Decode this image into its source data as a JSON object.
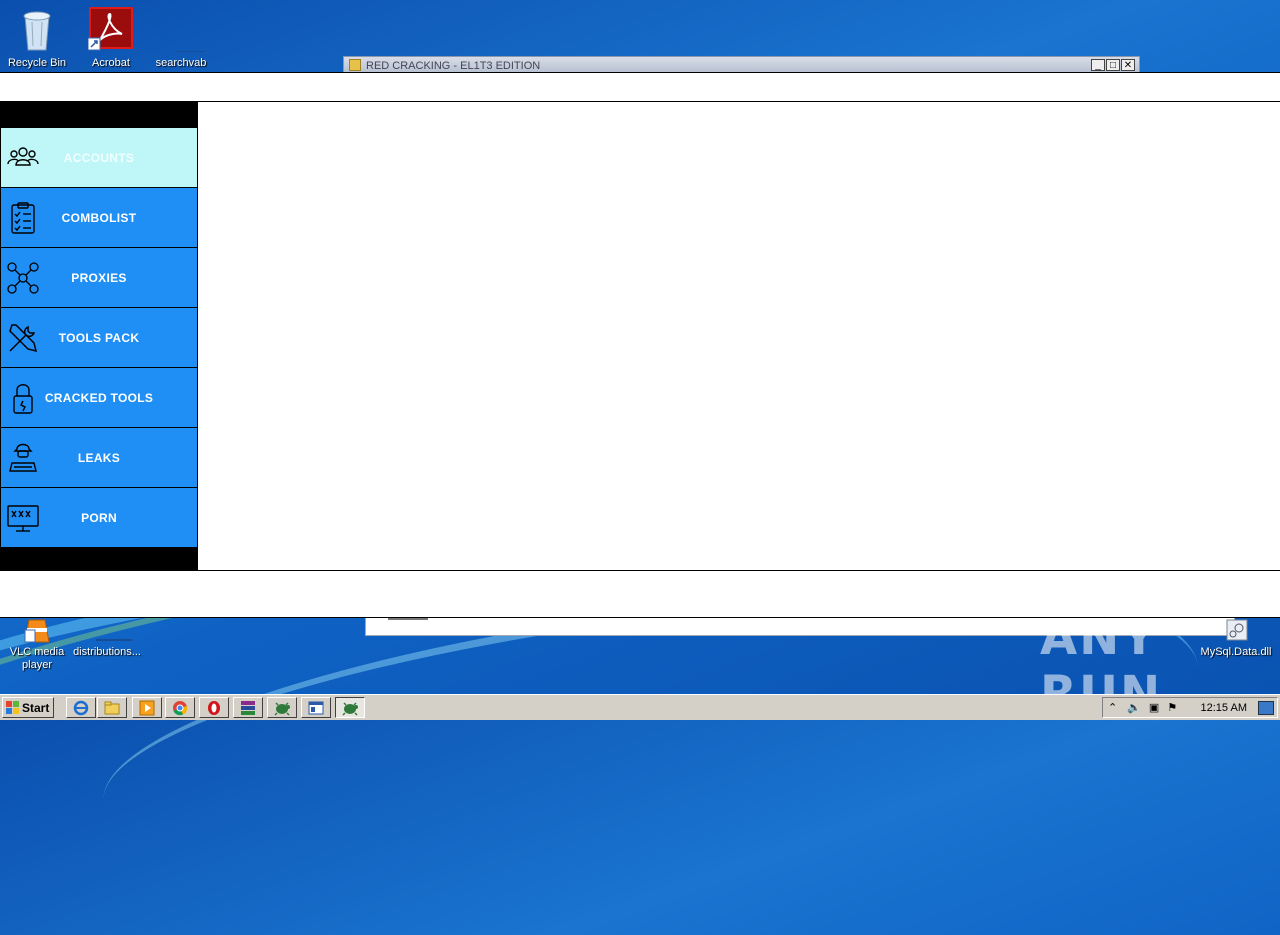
{
  "desktop": {
    "icons": [
      {
        "label": "Recycle Bin"
      },
      {
        "label": "Acrobat"
      },
      {
        "label": "searchvab"
      },
      {
        "label": "VLC media player"
      },
      {
        "label": "distributions..."
      },
      {
        "label": "MySql.Data.dll"
      }
    ],
    "watermark": "ANY RUN"
  },
  "background_window": {
    "title": "RED CRACKING - EL1T3 EDITION"
  },
  "app": {
    "menu": [
      {
        "label": "ACCOUNTS",
        "icon": "users-group-icon",
        "active": true
      },
      {
        "label": "COMBOLIST",
        "icon": "clipboard-checklist-icon",
        "active": false
      },
      {
        "label": "PROXIES",
        "icon": "network-nodes-icon",
        "active": false
      },
      {
        "label": "TOOLS PACK",
        "icon": "wrench-screwdriver-icon",
        "active": false
      },
      {
        "label": "CRACKED TOOLS",
        "icon": "padlock-icon",
        "active": false
      },
      {
        "label": "LEAKS",
        "icon": "hacker-laptop-icon",
        "active": false
      },
      {
        "label": "PORN",
        "icon": "xxx-monitor-icon",
        "active": false
      }
    ],
    "colors": {
      "menu_bg": "#1f8ff6",
      "menu_active_bg": "#bff6f8",
      "sidebar_bg": "#000000"
    }
  },
  "taskbar": {
    "start_label": "Start",
    "clock": "12:15 AM",
    "buttons": [
      "ie-icon",
      "explorer-icon",
      "media-player-icon",
      "chrome-icon",
      "opera-icon",
      "winrar-icon",
      "app-turtle-icon",
      "window-icon",
      "app-turtle-active-icon"
    ]
  }
}
